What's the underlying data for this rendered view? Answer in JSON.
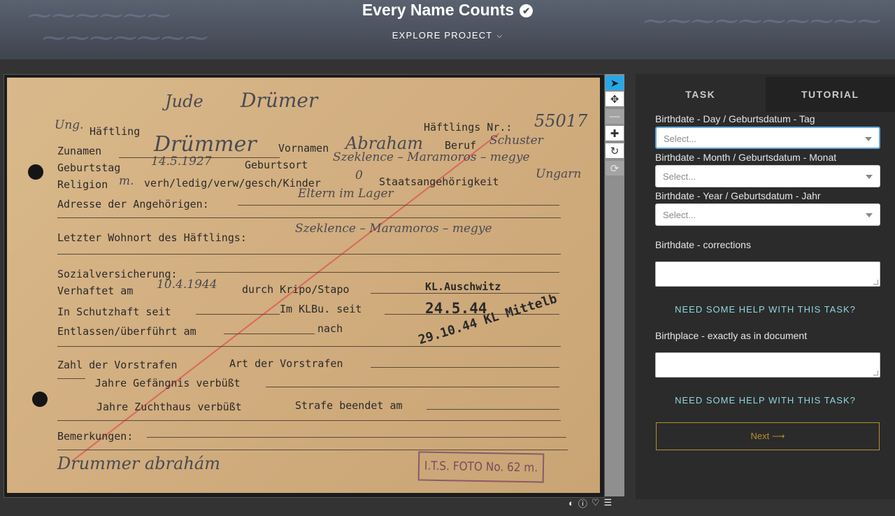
{
  "header": {
    "title": "Every Name Counts",
    "explore_label": "EXPLORE PROJECT"
  },
  "document": {
    "hw_jude": "Jude",
    "hw_surname_top": "Drümer",
    "hw_ung": "Ung.",
    "label_haeftling": "Häftling",
    "label_haeftlings_nr": "Häftlings Nr.:",
    "hw_number": "55017",
    "label_zunamen": "Zunamen",
    "hw_surname": "Drümmer",
    "label_vornamen": "Vornamen",
    "hw_firstname": "Abraham",
    "label_beruf": "Beruf",
    "hw_beruf": "Schuster",
    "label_geburtstag": "Geburtstag",
    "hw_birthdate": "14.5.1927",
    "label_geburtsort": "Geburtsort",
    "hw_birthplace": "Szeklence – Maramoros – megye",
    "label_religion": "Religion",
    "hw_religion": "m.",
    "label_status": "verh/ledig/verw/gesch/Kinder",
    "hw_kinder": "0",
    "label_staat": "Staatsangehörigkeit",
    "hw_staat": "Ungarn",
    "label_adresse": "Adresse der Angehörigen:",
    "hw_adresse": "Eltern im Lager",
    "label_wohnort": "Letzter Wohnort des Häftlings:",
    "hw_wohnort": "Szeklence – Maramoros – megye",
    "label_sozial": "Sozialversicherung:",
    "label_verhaftet": "Verhaftet am",
    "hw_verhaftet": "10.4.1944",
    "label_durch": "durch Kripo/Stapo",
    "stamp_kl": "KL.Auschwitz",
    "label_schutzhaft": "In Schutzhaft seit",
    "label_klbu": "Im KLBu. seit",
    "stamp_date": "24.5.44",
    "label_entlassen": "Entlassen/überführt am",
    "label_nach": "nach",
    "stamp_transfer": "29.10.44 KL Mittelb",
    "label_zahl": "Zahl der Vorstrafen",
    "label_art": "Art der Vorstrafen",
    "label_gefaengnis": "Jahre Gefängnis verbüßt",
    "label_zuchthaus": "Jahre Zuchthaus verbüßt",
    "label_strafe": "Strafe beendet am",
    "label_bemerkungen": "Bemerkungen:",
    "hw_signature": "Drummer abrahám",
    "stamp_its": "I.T.S. FOTO No. 62 m."
  },
  "tabs": {
    "task": "TASK",
    "tutorial": "TUTORIAL"
  },
  "form": {
    "day_label": "Birthdate - Day / Geburtsdatum - Tag",
    "day_placeholder": "Select...",
    "month_label": "Birthdate - Month / Geburtsdatum - Monat",
    "month_placeholder": "Select...",
    "year_label": "Birthdate - Year / Geburtsdatum - Jahr",
    "year_placeholder": "Select...",
    "corrections_label": "Birthdate - corrections",
    "help_1": "NEED SOME HELP WITH THIS TASK?",
    "birthplace_label": "Birthplace - exactly as in document",
    "help_2": "NEED SOME HELP WITH THIS TASK?",
    "next_label": "Next",
    "next_arrow": "⟶"
  },
  "colors": {
    "accent": "#27a7e7",
    "help_link": "#8fd6e0",
    "next_border": "#b88f2a"
  }
}
